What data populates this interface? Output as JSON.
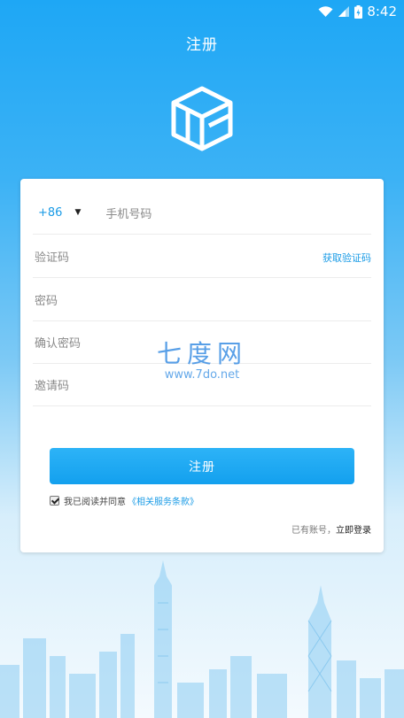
{
  "status_bar": {
    "time": "8:42"
  },
  "header": {
    "title": "注册"
  },
  "form": {
    "country_code": "+86",
    "dropdown_arrow": "▼",
    "phone_placeholder": "手机号码",
    "code_placeholder": "验证码",
    "get_code_label": "获取验证码",
    "password_placeholder": "密码",
    "confirm_placeholder": "确认密码",
    "invite_placeholder": "邀请码",
    "submit_label": "注册",
    "agree_text": "我已阅读并同意",
    "terms_link": "《相关服务条款》",
    "has_account_text": "已有账号，",
    "login_link": "立即登录"
  },
  "watermark": {
    "brand": "七度网",
    "url": "www.7do.net"
  },
  "icons": [
    "wifi-icon",
    "signal-icon",
    "battery-icon",
    "app-logo-cube-icon",
    "checkbox-checked-icon"
  ],
  "colors": {
    "accent": "#1a9be6",
    "button": "#18a3ef",
    "header_bg": "#1ea7f5"
  }
}
